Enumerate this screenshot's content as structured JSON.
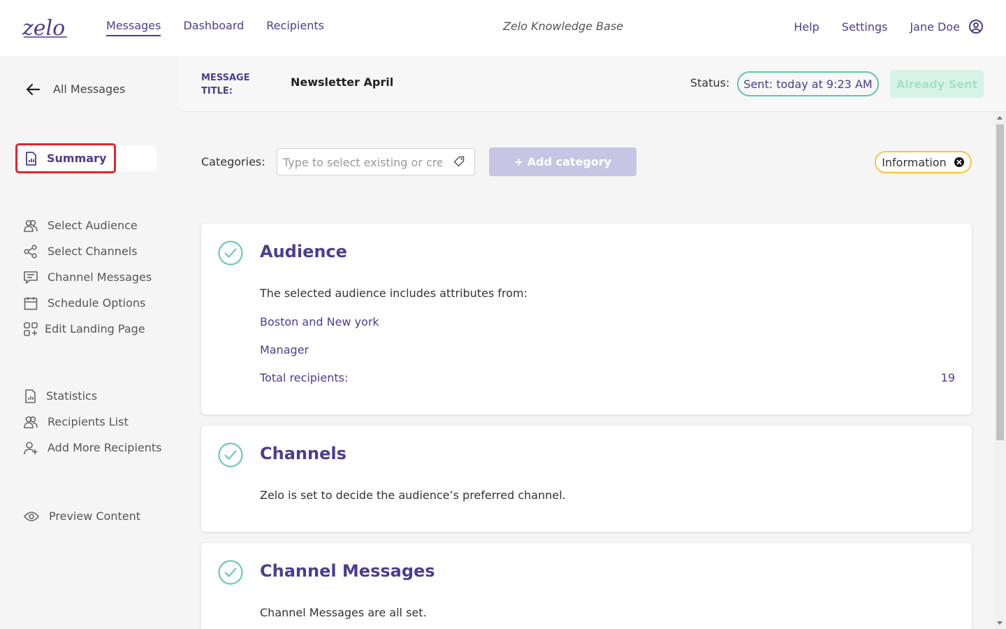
{
  "topbar": {
    "logo_text": "ZELO",
    "nav": [
      {
        "label": "Messages",
        "active": true
      },
      {
        "label": "Dashboard",
        "active": false
      },
      {
        "label": "Recipients",
        "active": false
      }
    ],
    "knowledge_base": "Zelo Knowledge Base",
    "help": "Help",
    "settings": "Settings",
    "user_name": "Jane Doe"
  },
  "sidebar": {
    "back_label": "All Messages",
    "summary_label": "Summary",
    "group1": [
      "Select Audience",
      "Select Channels",
      "Channel Messages",
      "Schedule Options",
      "Edit Landing Page"
    ],
    "group2": [
      "Statistics",
      "Recipients List",
      "Add More Recipients"
    ],
    "group3": [
      "Preview Content"
    ]
  },
  "header": {
    "title_label_line1": "MESSAGE",
    "title_label_line2": "TITLE:",
    "title_value": "Newsletter April",
    "status_label": "Status:",
    "status_value": "Sent: today at 9:23 AM",
    "sent_button": "Already Sent"
  },
  "categories": {
    "label": "Categories:",
    "placeholder": "Type to select existing or create new",
    "add_button": "+ Add category",
    "info_label": "Information"
  },
  "cards": {
    "audience": {
      "title": "Audience",
      "intro": "The selected audience includes attributes from:",
      "attr1": "Boston and New york",
      "attr2": "Manager",
      "total_label": "Total recipients:",
      "total_value": "19"
    },
    "channels": {
      "title": "Channels",
      "text": "Zelo is set to decide the audience’s preferred channel."
    },
    "channel_messages": {
      "title": "Channel Messages",
      "text": "Channel Messages are all set."
    }
  },
  "colors": {
    "brand": "#4a3e8f",
    "success": "#5dc8a5",
    "highlight": "#e0262e",
    "warning": "#f5c542"
  }
}
